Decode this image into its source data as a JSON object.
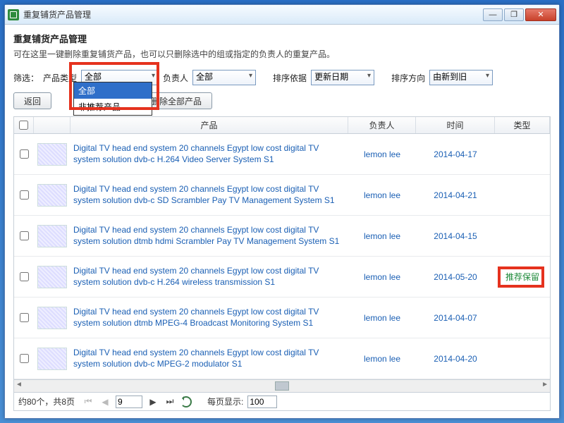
{
  "window": {
    "title": "重复铺货产品管理"
  },
  "header": {
    "title": "重复铺货产品管理",
    "desc": "可在这里一键删除重复铺货产品，也可以只删除选中的组或指定的负责人的重复产品。"
  },
  "filter": {
    "label": "筛选：",
    "productTypeLabel": "产品类型",
    "productTypeValue": "全部",
    "dropdownOptions": [
      "全部",
      "非推荐产品"
    ],
    "ownerLabel": "负责人",
    "ownerValue": "全部",
    "sortByLabel": "排序依据",
    "sortByValue": "更新日期",
    "sortDirLabel": "排序方向",
    "sortDirValue": "由新到旧"
  },
  "buttons": {
    "back": "返回",
    "deleteAll": "删除全部产品"
  },
  "columns": {
    "product": "产品",
    "owner": "负责人",
    "time": "时间",
    "type": "类型"
  },
  "rows": [
    {
      "product": "Digital TV head end system 20 channels Egypt low cost digital TV system solution dvb-c H.264 Video Server System S1",
      "owner": "lemon lee",
      "time": "2014-04-17",
      "type": ""
    },
    {
      "product": "Digital TV head end system 20 channels Egypt low cost digital TV system solution dvb-c SD Scrambler Pay TV Management System S1",
      "owner": "lemon lee",
      "time": "2014-04-21",
      "type": ""
    },
    {
      "product": "Digital TV head end system 20 channels Egypt low cost digital TV system solution dtmb hdmi Scrambler Pay TV Management System S1",
      "owner": "lemon lee",
      "time": "2014-04-15",
      "type": ""
    },
    {
      "product": "Digital TV head end system 20 channels Egypt low cost digital TV system solution dvb-c H.264 wireless transmission S1",
      "owner": "lemon lee",
      "time": "2014-05-20",
      "type": "推荐保留"
    },
    {
      "product": "Digital TV head end system 20 channels Egypt low cost digital TV system solution dtmb MPEG-4 Broadcast Monitoring System S1",
      "owner": "lemon lee",
      "time": "2014-04-07",
      "type": ""
    },
    {
      "product": "Digital TV head end system 20 channels Egypt low cost digital TV system solution dvb-c MPEG-2 modulator S1",
      "owner": "lemon lee",
      "time": "2014-04-20",
      "type": ""
    }
  ],
  "pager": {
    "summary": "约80个，共8页",
    "page": "9",
    "perPageLabel": "每页显示:",
    "perPage": "100"
  }
}
